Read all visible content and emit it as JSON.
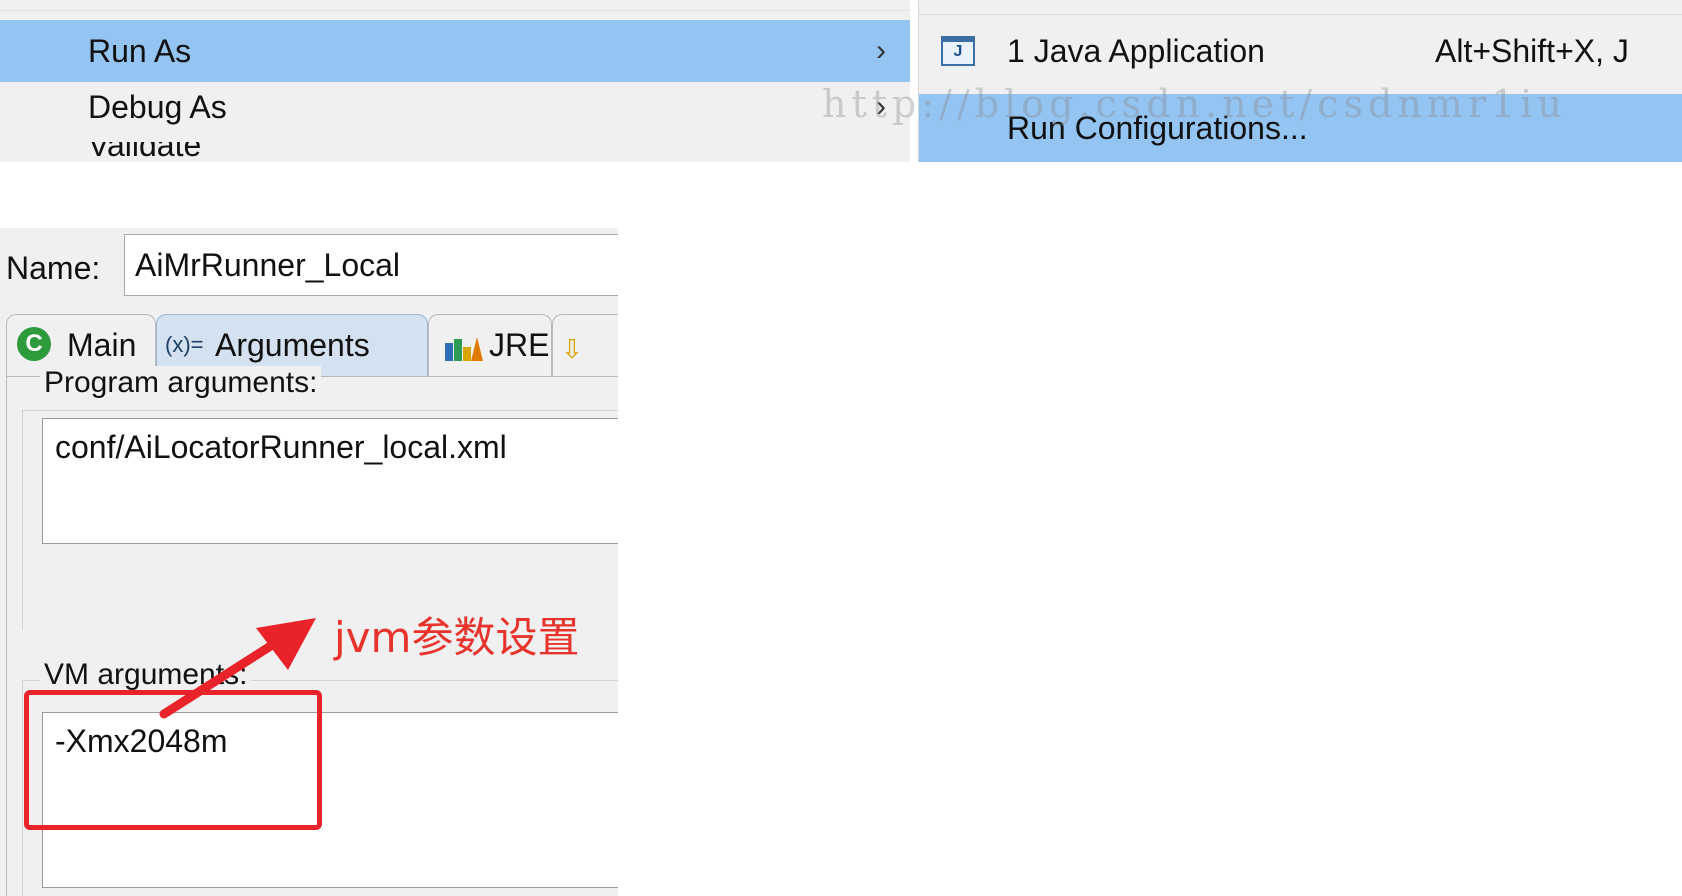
{
  "context_menu": {
    "items": [
      {
        "label": "Run As",
        "has_submenu": true,
        "selected": true
      },
      {
        "label": "Debug As",
        "has_submenu": true,
        "selected": false
      },
      {
        "label": "Validate",
        "has_submenu": false,
        "selected": false
      }
    ],
    "submenu_arrow": "›"
  },
  "run_as_submenu": {
    "items": [
      {
        "label": "1 Java Application",
        "accelerator": "Alt+Shift+X, J",
        "icon": "java-application-icon",
        "selected": false
      },
      {
        "label": "Run Configurations...",
        "selected": true
      }
    ],
    "java_icon_glyph": "J"
  },
  "watermark": "http://blog.csdn.net/csdnmr1iu",
  "dialog": {
    "name_label": "Name:",
    "name_value": "AiMrRunner_Local",
    "tabs": [
      {
        "label": "Main",
        "icon": "main-class-icon",
        "active": false
      },
      {
        "label": "Arguments",
        "icon": "arguments-icon",
        "active": true
      },
      {
        "label": "JRE",
        "icon": "jre-library-icon",
        "active": false
      },
      {
        "label": "",
        "icon": "classpath-icon",
        "active": false
      }
    ],
    "main_icon_glyph": "C",
    "args_icon_glyph": "(x)=",
    "program_arguments_label": "Program arguments:",
    "program_arguments_value": "conf/AiLocatorRunner_local.xml",
    "vm_arguments_label": "VM arguments:",
    "vm_arguments_value": "-Xmx2048m"
  },
  "annotation": {
    "text": "jvm参数设置",
    "color": "#e8332c"
  },
  "colors": {
    "menu_bg": "#f0f0f0",
    "selection": "#93c4f2",
    "annotation_red": "#e8232a"
  }
}
